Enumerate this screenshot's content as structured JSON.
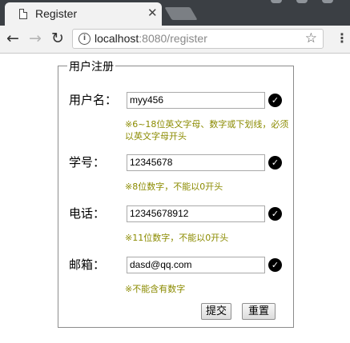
{
  "browser": {
    "tab_title": "Register",
    "url_host": "localhost",
    "url_rest": ":8080/register"
  },
  "form": {
    "legend": "用户注册",
    "fields": [
      {
        "label": "用户名：",
        "value": "myy456",
        "hint": "※6~18位英文字母、数字或下划线，必须以英文字母开头"
      },
      {
        "label": "学号：",
        "value": "12345678",
        "hint": "※8位数字，不能以0开头"
      },
      {
        "label": "电话：",
        "value": "12345678912",
        "hint": "※11位数字，不能以0开头"
      },
      {
        "label": "邮箱：",
        "value": "dasd@qq.com",
        "hint": "※不能含有数字"
      }
    ],
    "submit_label": "提交",
    "reset_label": "重置"
  },
  "colors": {
    "hint": "#8b8b00",
    "tabbar": "#3b3f44",
    "valid_icon": "#000000"
  },
  "icons": [
    "document-icon",
    "close-icon",
    "back-arrow-icon",
    "forward-arrow-icon",
    "reload-icon",
    "info-icon",
    "star-icon",
    "menu-icon",
    "check-circle-icon"
  ]
}
